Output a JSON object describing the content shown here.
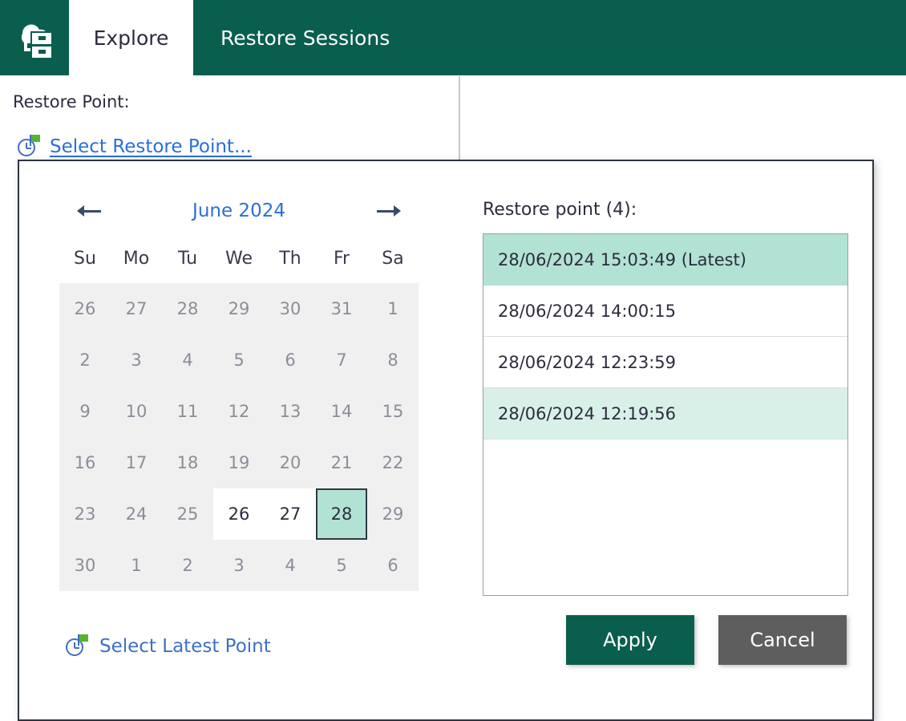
{
  "colors": {
    "brand_green": "#0a5e4d",
    "link_blue": "#2a6fdb",
    "selected_teal": "#b2e2d4",
    "hover_teal": "#d9f0e8",
    "cancel_gray": "#5e5e5e",
    "flag_green": "#55b332"
  },
  "topbar": {
    "logo_icon": "cloud-archive-icon",
    "tabs": [
      {
        "label": "Explore",
        "active": true
      },
      {
        "label": "Restore Sessions",
        "active": false
      }
    ]
  },
  "background": {
    "restore_point_label": "Restore Point:",
    "select_restore_point_link": "Select Restore Point...",
    "select_restore_point_icon": "clock-flag-icon"
  },
  "dialog": {
    "calendar": {
      "prev_icon": "arrow-left-icon",
      "next_icon": "arrow-right-icon",
      "title": "June 2024",
      "day_headers": [
        "Su",
        "Mo",
        "Tu",
        "We",
        "Th",
        "Fr",
        "Sa"
      ],
      "weeks": [
        [
          {
            "n": "26",
            "state": "other"
          },
          {
            "n": "27",
            "state": "other"
          },
          {
            "n": "28",
            "state": "other"
          },
          {
            "n": "29",
            "state": "other"
          },
          {
            "n": "30",
            "state": "other"
          },
          {
            "n": "31",
            "state": "other"
          },
          {
            "n": "1",
            "state": "in-month"
          }
        ],
        [
          {
            "n": "2",
            "state": "in-month"
          },
          {
            "n": "3",
            "state": "in-month"
          },
          {
            "n": "4",
            "state": "in-month"
          },
          {
            "n": "5",
            "state": "in-month"
          },
          {
            "n": "6",
            "state": "in-month"
          },
          {
            "n": "7",
            "state": "in-month"
          },
          {
            "n": "8",
            "state": "in-month"
          }
        ],
        [
          {
            "n": "9",
            "state": "in-month"
          },
          {
            "n": "10",
            "state": "in-month"
          },
          {
            "n": "11",
            "state": "in-month"
          },
          {
            "n": "12",
            "state": "in-month"
          },
          {
            "n": "13",
            "state": "in-month"
          },
          {
            "n": "14",
            "state": "in-month"
          },
          {
            "n": "15",
            "state": "in-month"
          }
        ],
        [
          {
            "n": "16",
            "state": "in-month"
          },
          {
            "n": "17",
            "state": "in-month"
          },
          {
            "n": "18",
            "state": "in-month"
          },
          {
            "n": "19",
            "state": "in-month"
          },
          {
            "n": "20",
            "state": "in-month"
          },
          {
            "n": "21",
            "state": "in-month"
          },
          {
            "n": "22",
            "state": "in-month"
          }
        ],
        [
          {
            "n": "23",
            "state": "in-month"
          },
          {
            "n": "24",
            "state": "in-month"
          },
          {
            "n": "25",
            "state": "in-month"
          },
          {
            "n": "26",
            "state": "available"
          },
          {
            "n": "27",
            "state": "available"
          },
          {
            "n": "28",
            "state": "selected"
          },
          {
            "n": "29",
            "state": "in-month"
          }
        ],
        [
          {
            "n": "30",
            "state": "in-month"
          },
          {
            "n": "1",
            "state": "other"
          },
          {
            "n": "2",
            "state": "other"
          },
          {
            "n": "3",
            "state": "other"
          },
          {
            "n": "4",
            "state": "other"
          },
          {
            "n": "5",
            "state": "other"
          },
          {
            "n": "6",
            "state": "other"
          }
        ]
      ]
    },
    "select_latest": {
      "icon": "clock-flag-icon",
      "label": "Select Latest Point"
    },
    "restore_points": {
      "label": "Restore point (4):",
      "count": 4,
      "items": [
        {
          "text": "28/06/2024 15:03:49 (Latest)",
          "state": "selected"
        },
        {
          "text": "28/06/2024 14:00:15",
          "state": "normal"
        },
        {
          "text": "28/06/2024 12:23:59",
          "state": "normal"
        },
        {
          "text": "28/06/2024 12:19:56",
          "state": "hovered"
        }
      ]
    },
    "buttons": {
      "apply": "Apply",
      "cancel": "Cancel"
    }
  }
}
